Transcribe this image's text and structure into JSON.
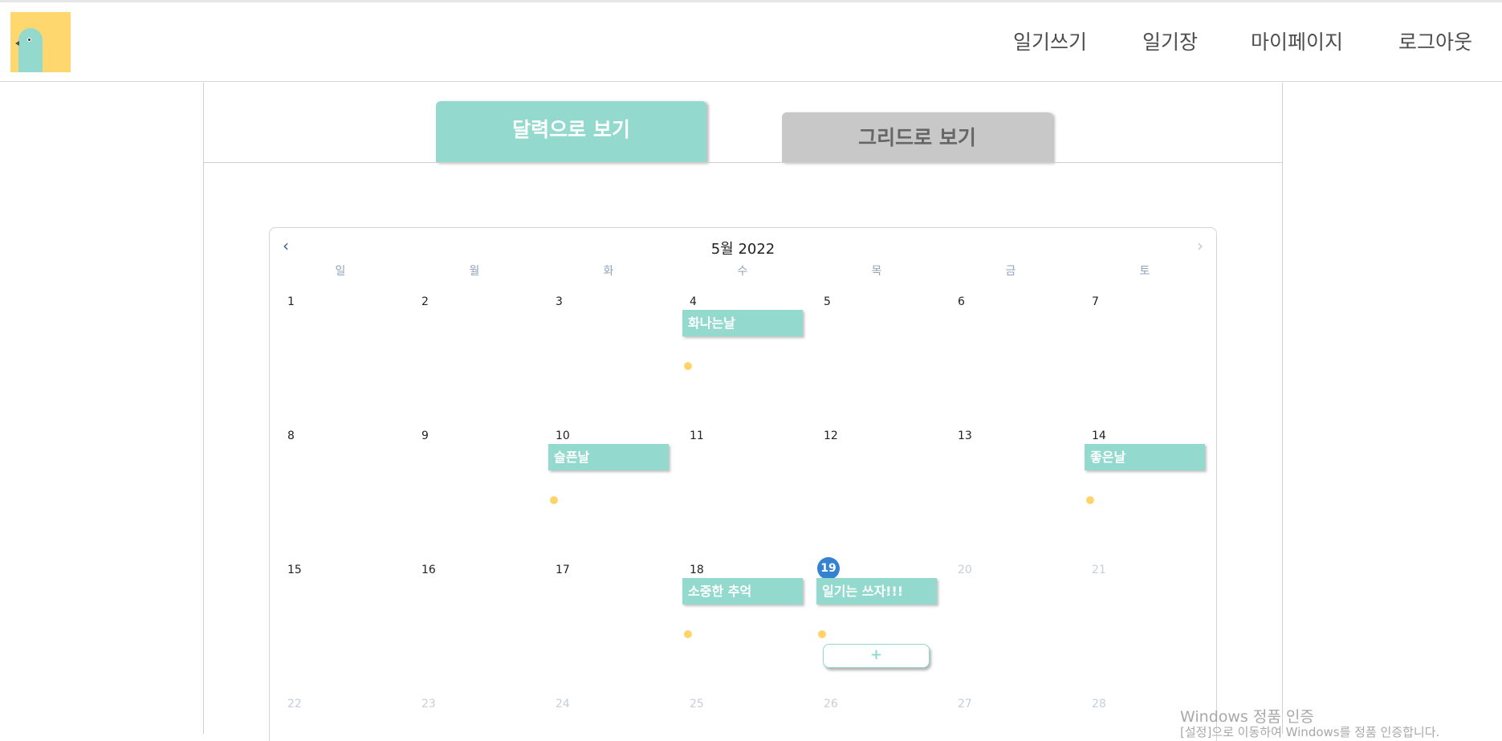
{
  "header": {
    "nav": [
      "일기쓰기",
      "일기장",
      "마이페이지",
      "로그아웃"
    ]
  },
  "tabs": {
    "calendar": "달력으로 보기",
    "grid": "그리드로 보기"
  },
  "calendar": {
    "title": "5월 2022",
    "prev_icon": "chevron-left-icon",
    "next_icon": "chevron-right-icon",
    "weekdays": [
      "일",
      "월",
      "화",
      "수",
      "목",
      "금",
      "토"
    ],
    "weeks": [
      [
        "1",
        "2",
        "3",
        "4",
        "5",
        "6",
        "7"
      ],
      [
        "8",
        "9",
        "10",
        "11",
        "12",
        "13",
        "14"
      ],
      [
        "15",
        "16",
        "17",
        "18",
        "19",
        "20",
        "21"
      ],
      [
        "22",
        "23",
        "24",
        "25",
        "26",
        "27",
        "28"
      ]
    ],
    "today": "19",
    "events": [
      {
        "day": "4",
        "title": "화나는날"
      },
      {
        "day": "10",
        "title": "슬픈날"
      },
      {
        "day": "14",
        "title": "좋은날"
      },
      {
        "day": "18",
        "title": "소중한 추억"
      },
      {
        "day": "19",
        "title": "일기는 쓰자!!!"
      }
    ],
    "add_label": "+"
  },
  "watermark": {
    "line1": "Windows 정품 인증",
    "line2": "[설정]으로 이동하여 Windows를 정품 인증합니다."
  },
  "colors": {
    "accent": "#94d9ce",
    "logo_bg": "#fed76e",
    "dot": "#ffd46b",
    "today": "#3482d0",
    "tab_inactive": "#c8c8c8"
  }
}
